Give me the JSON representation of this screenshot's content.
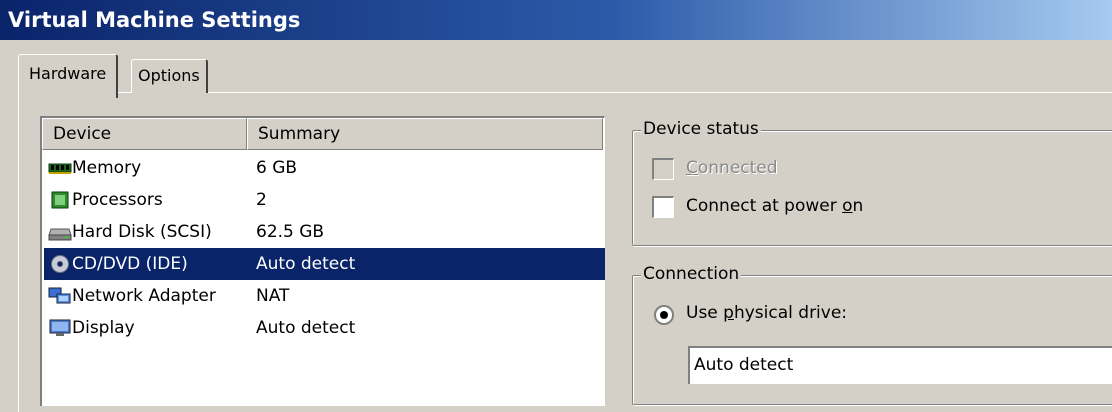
{
  "window": {
    "title": "Virtual Machine Settings"
  },
  "tabs": [
    {
      "label": "Hardware",
      "active": true
    },
    {
      "label": "Options",
      "active": false
    }
  ],
  "device_list": {
    "columns": [
      "Device",
      "Summary"
    ],
    "rows": [
      {
        "icon": "memory-icon",
        "device": "Memory",
        "summary": "6 GB",
        "selected": false
      },
      {
        "icon": "processor-icon",
        "device": "Processors",
        "summary": "2",
        "selected": false
      },
      {
        "icon": "hard-disk-icon",
        "device": "Hard Disk (SCSI)",
        "summary": "62.5 GB",
        "selected": false
      },
      {
        "icon": "cd-dvd-icon",
        "device": "CD/DVD (IDE)",
        "summary": "Auto detect",
        "selected": true
      },
      {
        "icon": "network-adapter-icon",
        "device": "Network Adapter",
        "summary": "NAT",
        "selected": false
      },
      {
        "icon": "display-icon",
        "device": "Display",
        "summary": "Auto detect",
        "selected": false
      }
    ]
  },
  "device_status": {
    "title": "Device status",
    "connected": {
      "pre": "",
      "u": "C",
      "post": "onnected",
      "checked": false,
      "enabled": false
    },
    "connect_at_power_on": {
      "pre": "Connect at power ",
      "u": "o",
      "post": "n",
      "checked": false,
      "enabled": true
    }
  },
  "connection": {
    "title": "Connection",
    "use_physical_drive": {
      "pre": "Use ",
      "u": "p",
      "post": "hysical drive:",
      "selected": true
    },
    "drive_value": "Auto detect"
  },
  "colors": {
    "selection": "#0a246a",
    "face": "#d4d0c8",
    "title_start": "#0a246a",
    "title_end": "#a6caf0"
  }
}
